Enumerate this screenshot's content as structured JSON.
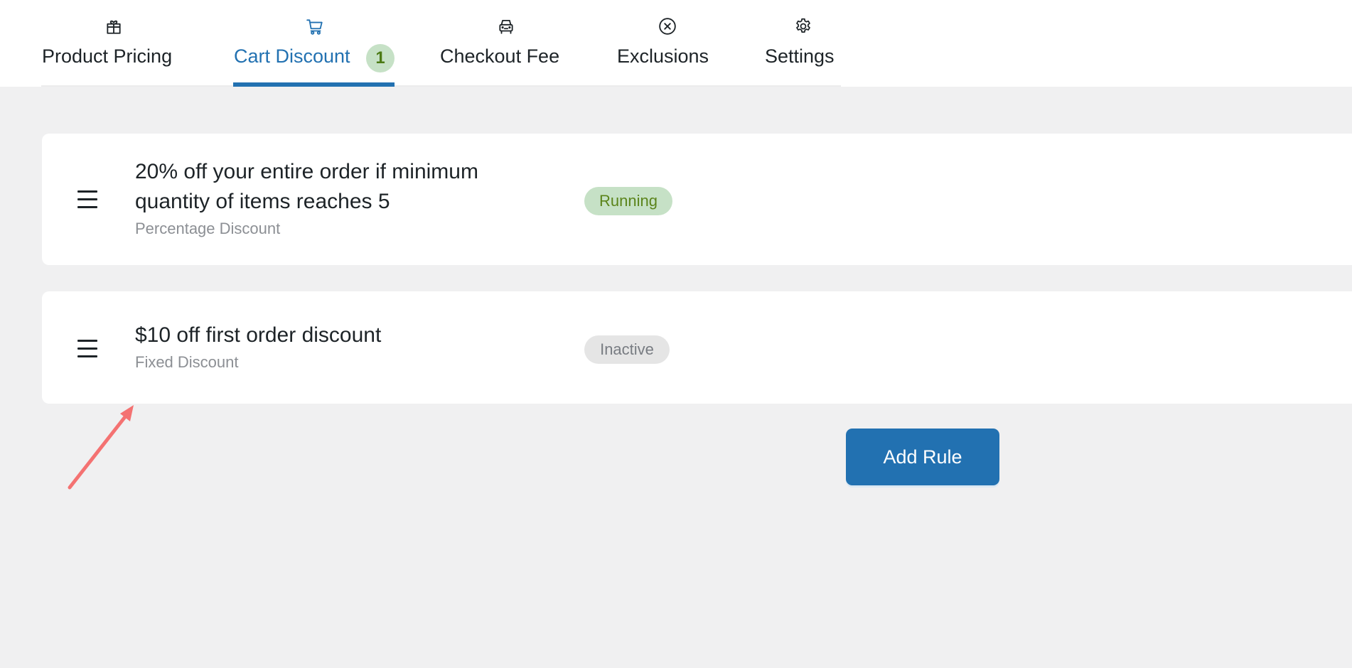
{
  "tabs": [
    {
      "label": "Product Pricing",
      "icon": "gift-icon",
      "active": false
    },
    {
      "label": "Cart Discount",
      "icon": "cart-icon",
      "active": true,
      "count": "1"
    },
    {
      "label": "Checkout Fee",
      "icon": "car-icon",
      "active": false
    },
    {
      "label": "Exclusions",
      "icon": "x-circle-icon",
      "active": false
    },
    {
      "label": "Settings",
      "icon": "gear-icon",
      "active": false
    }
  ],
  "rules": [
    {
      "title": "20% off your entire order if minimum quantity of items reaches 5",
      "type": "Percentage Discount",
      "status": "Running"
    },
    {
      "title": "$10 off first order discount",
      "type": "Fixed Discount",
      "status": "Inactive"
    }
  ],
  "actions": {
    "add_rule_label": "Add Rule"
  },
  "colors": {
    "accent": "#2271b1",
    "running_bg": "#c6e1c6",
    "running_text": "#5b841b",
    "inactive_bg": "#e5e5e5",
    "inactive_text": "#787c82",
    "annotation": "#f47272"
  }
}
